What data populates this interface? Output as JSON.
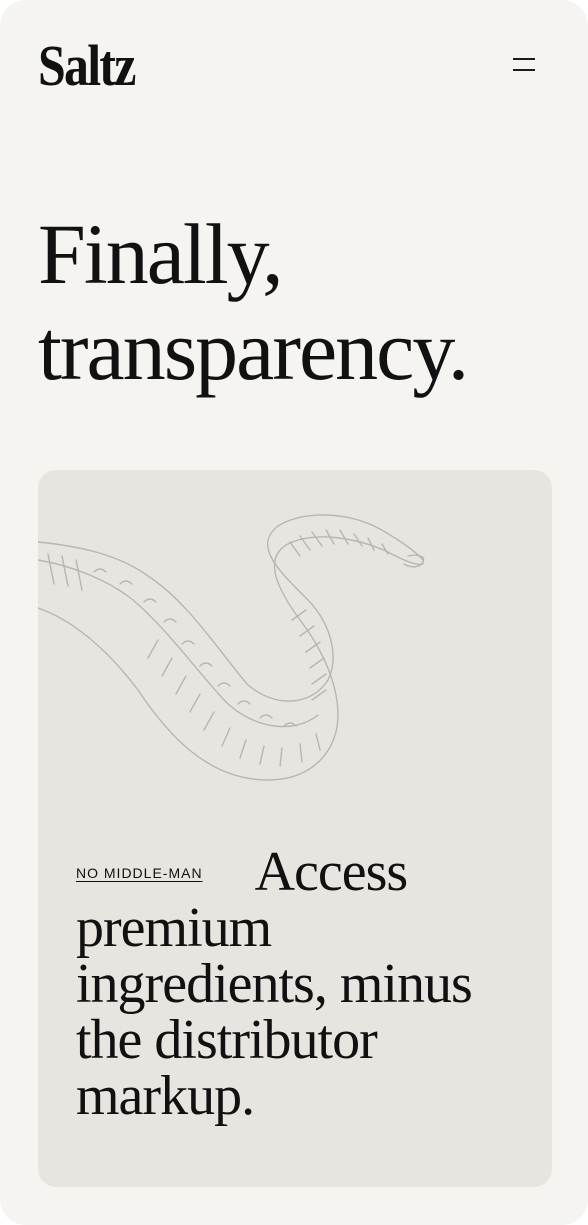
{
  "header": {
    "logo_text": "Saltz",
    "menu_icon": "hamburger-menu-icon"
  },
  "hero": {
    "title_line_1": "Finally,",
    "title_line_2": "transparency."
  },
  "feature_card": {
    "illustration": "octopus-tentacle-sketch",
    "label": "NO MIDDLE-MAN",
    "text": "Access premium ingredients, minus the distributor markup."
  },
  "colors": {
    "page_background": "#f5f4f0",
    "card_background": "#e8e4df",
    "text": "#111111",
    "sketch_lines": "#b9b6b1"
  }
}
